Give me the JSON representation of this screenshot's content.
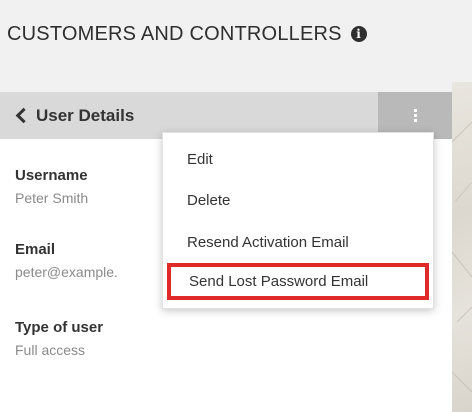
{
  "page": {
    "title": "CUSTOMERS AND CONTROLLERS",
    "info_icon": "info-icon"
  },
  "panel": {
    "back_label": "User Details",
    "back_icon": "chevron-left-icon",
    "menu_icon": "kebab-menu-icon",
    "fields": {
      "username_label": "Username",
      "username_value": "Peter Smith",
      "email_label": "Email",
      "email_value": "peter@example.",
      "type_label": "Type of user",
      "type_value": "Full access"
    }
  },
  "menu": {
    "items": [
      {
        "label": "Edit"
      },
      {
        "label": "Delete"
      },
      {
        "label": "Resend Activation Email"
      },
      {
        "label": "Send Lost Password Email",
        "highlighted": true
      }
    ],
    "highlight_color": "#e02a2a"
  },
  "colors": {
    "header_bg": "#d9d9d9",
    "kebab_bg": "#b9b9b9",
    "muted_text": "#8a8a8a"
  }
}
